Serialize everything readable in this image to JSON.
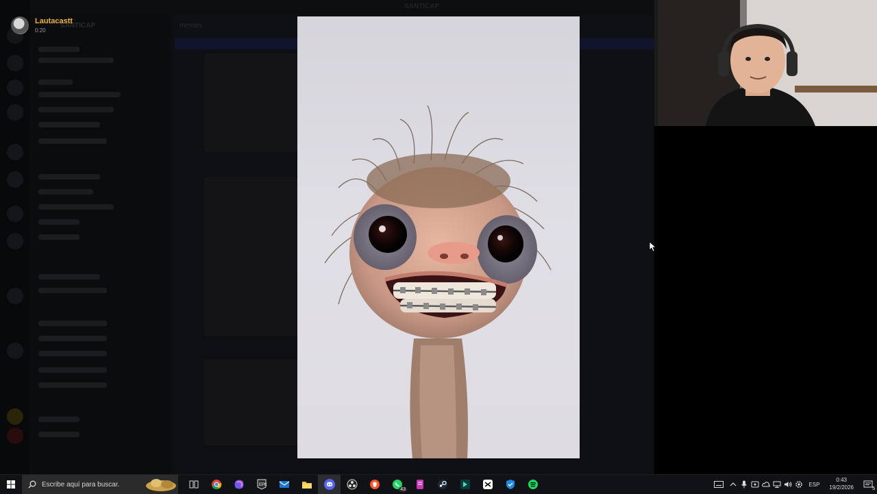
{
  "viewer": {
    "uploader_name": "Lautacastt",
    "uploader_time": "0:20"
  },
  "background_app": {
    "server_name": "SANTICAP",
    "channel_name": "memes",
    "window_title": "SANTICAP"
  },
  "taskbar": {
    "search_placeholder": "Escribe aquí para buscar.",
    "apps": [
      {
        "name": "task-view-icon"
      },
      {
        "name": "chrome-icon"
      },
      {
        "name": "copilot-icon"
      },
      {
        "name": "epic-games-icon"
      },
      {
        "name": "mail-icon"
      },
      {
        "name": "file-explorer-icon"
      },
      {
        "name": "discord-icon"
      },
      {
        "name": "obs-icon"
      },
      {
        "name": "brave-icon"
      },
      {
        "name": "whatsapp-icon",
        "badge": "43"
      },
      {
        "name": "notes-icon"
      },
      {
        "name": "steam-icon"
      },
      {
        "name": "launcher-icon"
      },
      {
        "name": "capcut-icon"
      },
      {
        "name": "security-icon"
      },
      {
        "name": "spotify-icon"
      }
    ],
    "tray": {
      "language": "ESP",
      "time": "0:43",
      "date": "19/2/2026",
      "notifications_badge": "5"
    }
  },
  "colors": {
    "uploader_name": "#f0b232",
    "taskbar_bg": "#111215"
  }
}
